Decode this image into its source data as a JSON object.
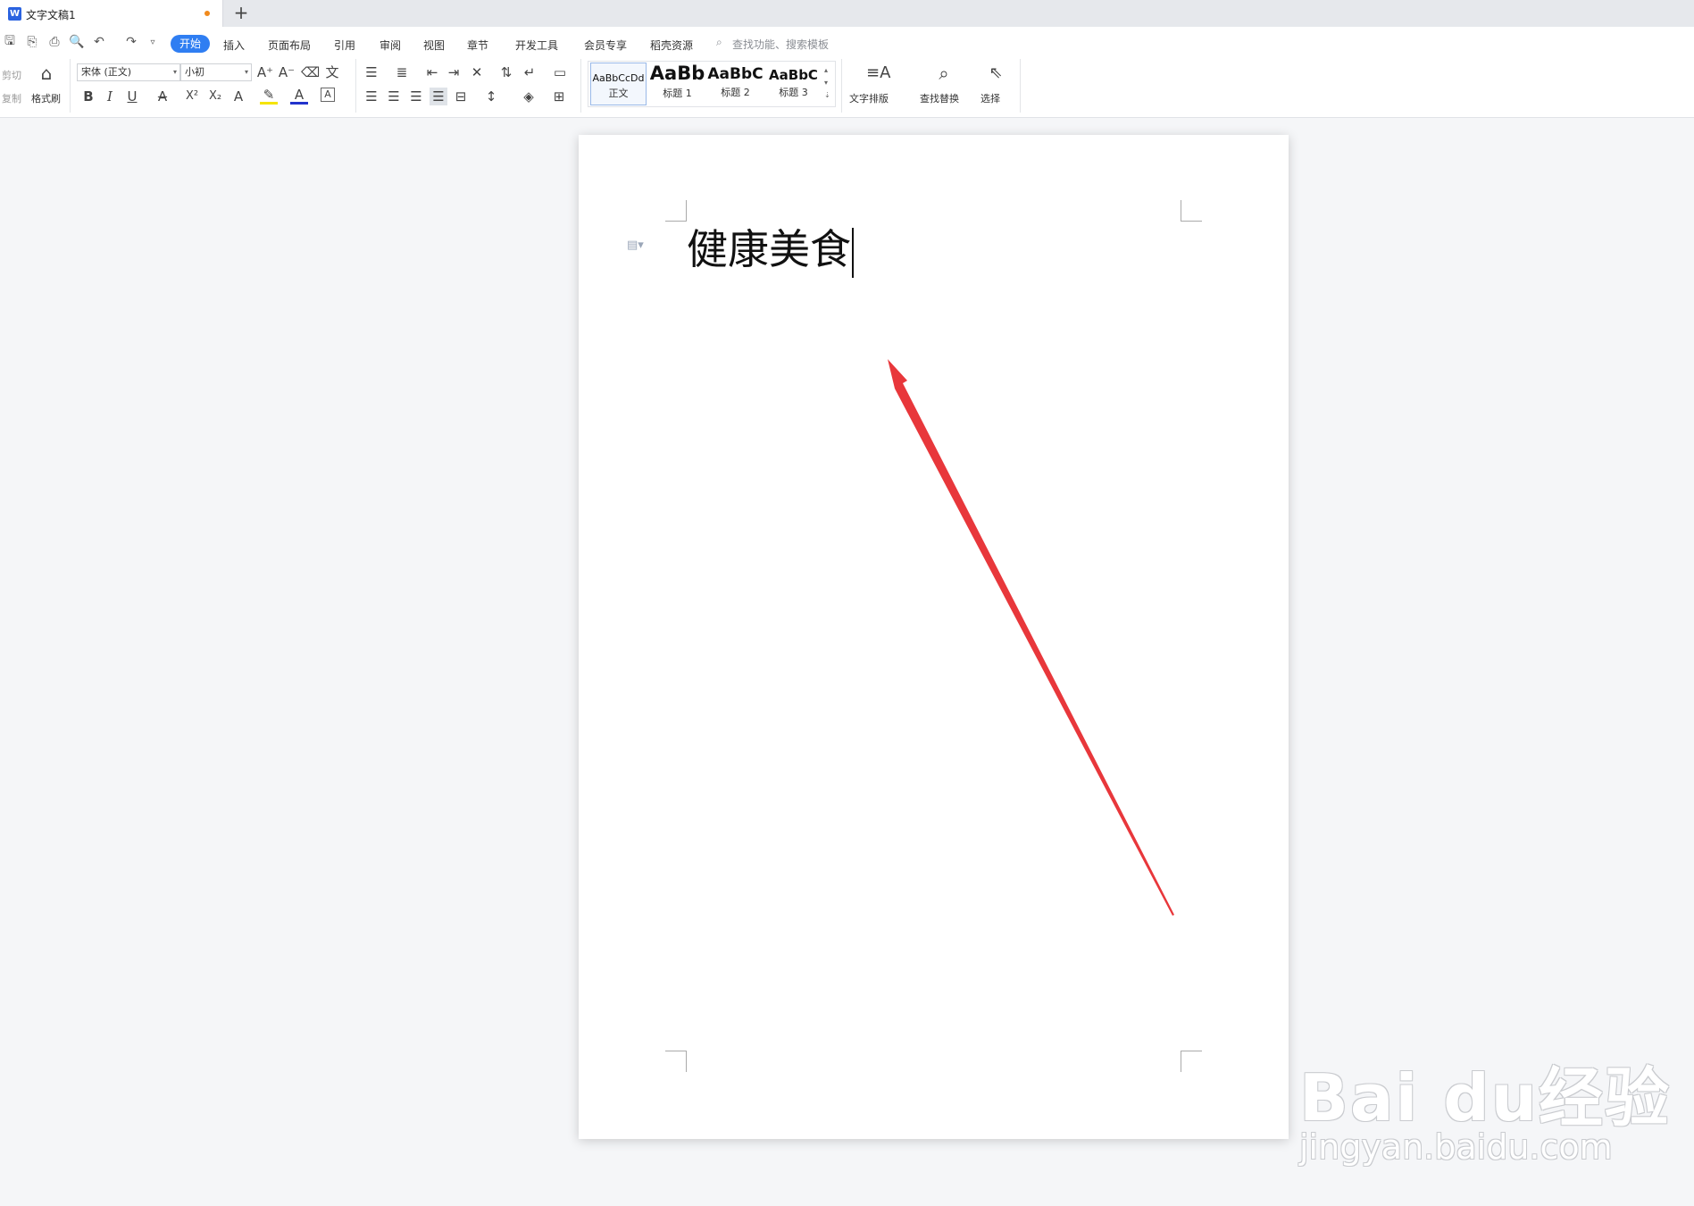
{
  "tab": {
    "title": "文字文稿1",
    "logo_letter": "W",
    "new_tab": "+"
  },
  "quick_access": [
    "save-icon",
    "export-pdf-icon",
    "print-icon",
    "print-preview-icon",
    "undo-icon",
    "redo-icon",
    "customize-icon"
  ],
  "menu": {
    "home": "开始",
    "items": [
      "插入",
      "页面布局",
      "引用",
      "审阅",
      "视图",
      "章节",
      "开发工具",
      "会员专享",
      "稻壳资源"
    ],
    "search_placeholder": "查找功能、搜索模板"
  },
  "clipboard": {
    "cut": "剪切",
    "copy": "复制",
    "format_painter": "格式刷"
  },
  "font": {
    "family": "宋体 (正文)",
    "size": "小初",
    "bold": "B",
    "italic": "I",
    "underline": "U",
    "strike": "A",
    "superscript": "X²",
    "subscript": "X₂",
    "effects": "A",
    "highlight": "✎",
    "font_color": "A",
    "char_border": "A"
  },
  "styles": [
    {
      "sample": "AaBbCcDd",
      "name": "正文"
    },
    {
      "sample": "AaBb",
      "name": "标题 1"
    },
    {
      "sample": "AaBbC",
      "name": "标题 2"
    },
    {
      "sample": "AaBbC",
      "name": "标题 3"
    }
  ],
  "tools": {
    "text_layout": "文字排版",
    "find_replace": "查找替换",
    "select": "选择"
  },
  "document": {
    "text": "健康美食"
  },
  "annotation": {
    "color": "#e8373b"
  },
  "watermark": {
    "main": "Bai du经验",
    "sub": "jingyan.baidu.com"
  },
  "colors": {
    "accent": "#2f7ef2",
    "unsaved": "#f08a1c",
    "highlight": "#f5e400",
    "font_color": "#2233cc"
  }
}
